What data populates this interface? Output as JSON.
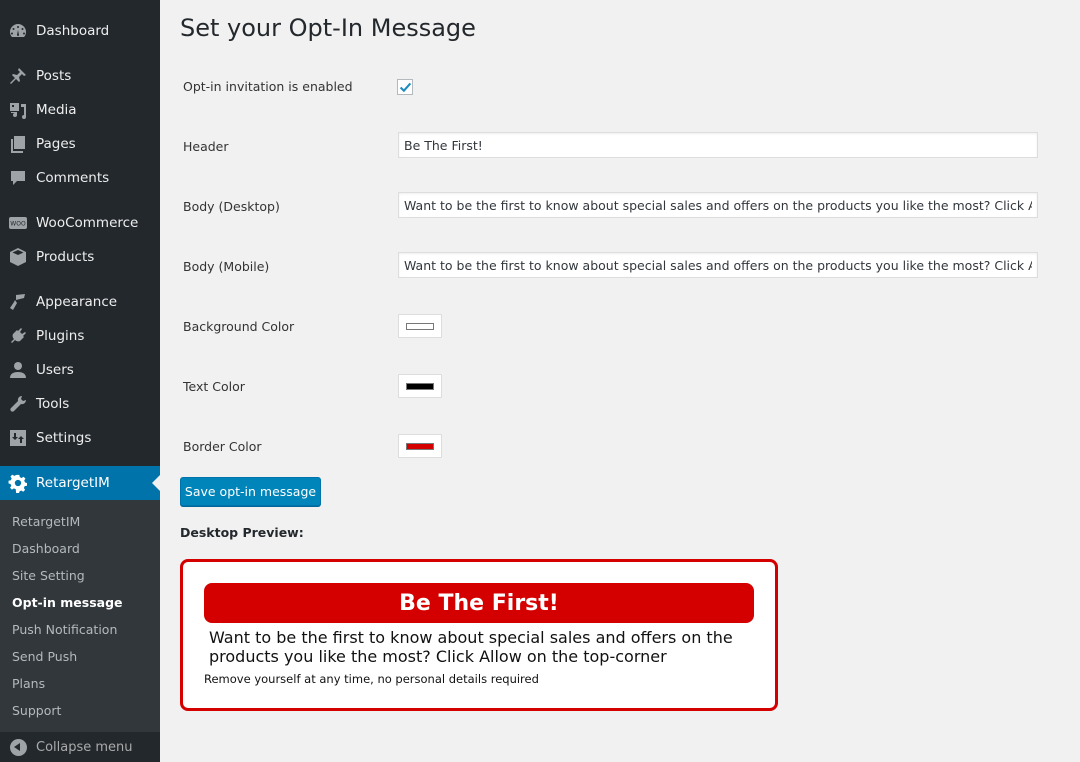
{
  "sidebar": {
    "items": [
      {
        "label": "Dashboard",
        "icon": "dashboard-icon"
      },
      {
        "label": "Posts",
        "icon": "pin-icon"
      },
      {
        "label": "Media",
        "icon": "media-icon"
      },
      {
        "label": "Pages",
        "icon": "pages-icon"
      },
      {
        "label": "Comments",
        "icon": "comment-icon"
      },
      {
        "label": "WooCommerce",
        "icon": "woo-icon"
      },
      {
        "label": "Products",
        "icon": "box-icon"
      },
      {
        "label": "Appearance",
        "icon": "paintbrush-icon"
      },
      {
        "label": "Plugins",
        "icon": "plug-icon"
      },
      {
        "label": "Users",
        "icon": "user-icon"
      },
      {
        "label": "Tools",
        "icon": "wrench-icon"
      },
      {
        "label": "Settings",
        "icon": "settings-sliders-icon"
      },
      {
        "label": "RetargetIM",
        "icon": "gear-icon",
        "current": true
      }
    ],
    "submenu": [
      {
        "label": "RetargetIM"
      },
      {
        "label": "Dashboard"
      },
      {
        "label": "Site Setting"
      },
      {
        "label": "Opt-in message",
        "current": true
      },
      {
        "label": "Push Notification"
      },
      {
        "label": "Send Push"
      },
      {
        "label": "Plans"
      },
      {
        "label": "Support"
      }
    ],
    "collapse_label": "Collapse menu"
  },
  "page": {
    "title": "Set your Opt-In Message",
    "form": {
      "enabled_label": "Opt-in invitation is enabled",
      "enabled_checked": true,
      "header_label": "Header",
      "header_value": "Be The First!",
      "body_desktop_label": "Body (Desktop)",
      "body_desktop_value": "Want to be the first to know about special sales and offers on the products you like the most? Click Allow on the top-corner",
      "body_mobile_label": "Body (Mobile)",
      "body_mobile_value": "Want to be the first to know about special sales and offers on the products you like the most? Click Allow on the top-corner",
      "bg_color_label": "Background Color",
      "bg_color": "#ffffff",
      "text_color_label": "Text Color",
      "text_color": "#000000",
      "border_color_label": "Border Color",
      "border_color": "#d40000"
    },
    "save_label": "Save opt-in message",
    "preview_label": "Desktop Preview:",
    "preview": {
      "header": "Be The First!",
      "body": "Want to be the first to know about special sales and offers on the products you like the most? Click Allow on the top-corner",
      "footer": "Remove yourself at any time, no personal details required",
      "accent": "#d40000"
    }
  }
}
